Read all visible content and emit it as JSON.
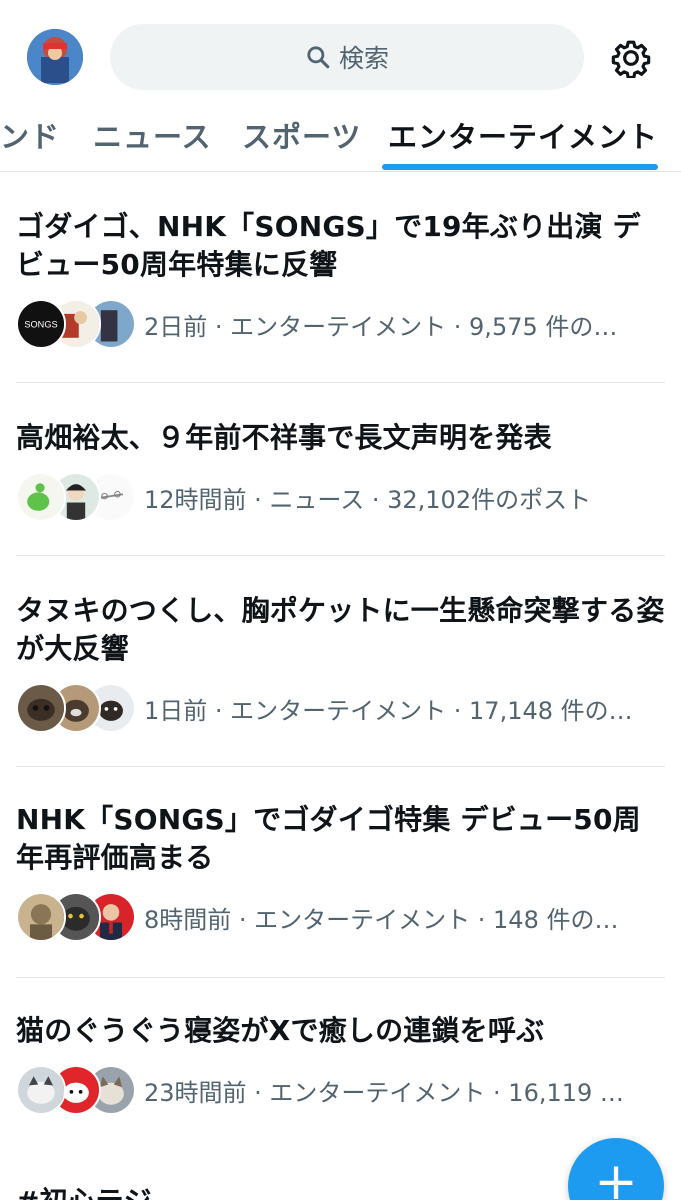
{
  "header": {
    "search_label": "検索"
  },
  "tabs": [
    {
      "label": "ンド",
      "active": false
    },
    {
      "label": "ニュース",
      "active": false
    },
    {
      "label": "スポーツ",
      "active": false
    },
    {
      "label": "エンターテイメント",
      "active": true
    }
  ],
  "feed": [
    {
      "title": "ゴダイゴ、NHK「SONGS」で19年ぶり出演 デビュー50周年特集に反響",
      "meta": "2日前 · エンターテイメント · 9,575 件の…",
      "avatar_badge": "SONGS"
    },
    {
      "title": "高畑裕太、９年前不祥事で長文声明を発表",
      "meta": "12時間前 · ニュース · 32,102件のポスト"
    },
    {
      "title": "タヌキのつくし、胸ポケットに一生懸命突撃する姿が大反響",
      "meta": "1日前 · エンターテイメント · 17,148 件の…"
    },
    {
      "title": "NHK「SONGS」でゴダイゴ特集 デビュー50周年再評価高まる",
      "meta": "8時間前 · エンターテイメント · 148 件の…"
    },
    {
      "title": "猫のぐうぐう寝姿がXで癒しの連鎖を呼ぶ",
      "meta": "23時間前 · エンターテイメント · 16,119 …"
    }
  ],
  "next_item_title": "#初心テジ",
  "fab": {
    "label": "+"
  },
  "colors": {
    "accent": "#1d9bf0",
    "text": "#0f1419",
    "muted": "#536471"
  }
}
